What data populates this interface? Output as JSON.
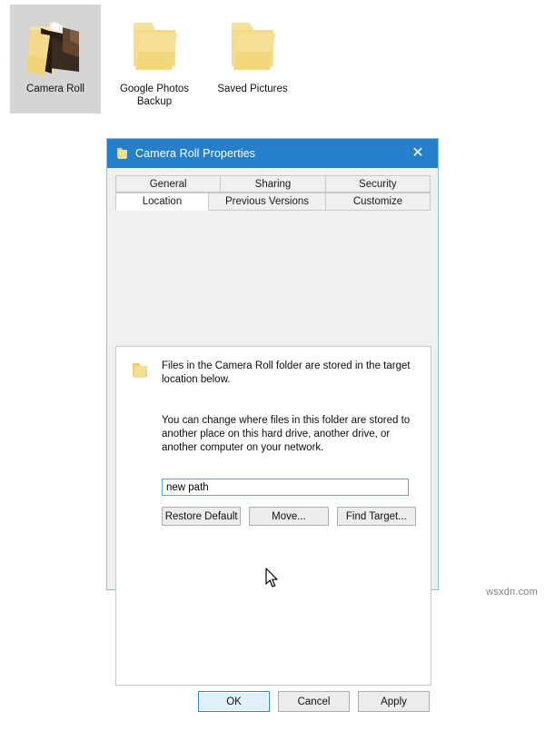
{
  "desktop": {
    "icons": [
      {
        "label": "Camera Roll",
        "icon": "open-folder-with-photo-icon",
        "selected": true
      },
      {
        "label": "Google Photos Backup",
        "icon": "folder-icon",
        "selected": false
      },
      {
        "label": "Saved Pictures",
        "icon": "folder-icon",
        "selected": false
      }
    ]
  },
  "dialog": {
    "title": "Camera Roll Properties",
    "title_icon": "folder-icon",
    "close_icon": "close-icon",
    "tabs_row1": [
      {
        "label": "General",
        "active": false
      },
      {
        "label": "Sharing",
        "active": false
      },
      {
        "label": "Security",
        "active": false
      }
    ],
    "tabs_row2": [
      {
        "label": "Location",
        "active": true
      },
      {
        "label": "Previous Versions",
        "active": false
      },
      {
        "label": "Customize",
        "active": false
      }
    ],
    "content": {
      "folder_icon": "folder-icon",
      "paragraph1": "Files in the Camera Roll folder are stored in the target location below.",
      "paragraph2": "You can change where files in this folder are stored to another place on this hard drive, another drive, or another computer on your network.",
      "path_value": "new path",
      "path_placeholder": "",
      "buttons": [
        {
          "label": "Restore Default"
        },
        {
          "label": "Move..."
        },
        {
          "label": "Find Target..."
        }
      ]
    },
    "footer_buttons": [
      {
        "label": "OK",
        "default": true
      },
      {
        "label": "Cancel",
        "default": false
      },
      {
        "label": "Apply",
        "default": false
      }
    ],
    "colors": {
      "titlebar": "#2480cd",
      "accent_border": "#2e8ad3",
      "default_button_fill": "#e2f0fb",
      "input_border": "#5ba4d4",
      "folder_yellow": "#f5d87a"
    }
  },
  "watermark": {
    "text": "wsxdn.com"
  }
}
